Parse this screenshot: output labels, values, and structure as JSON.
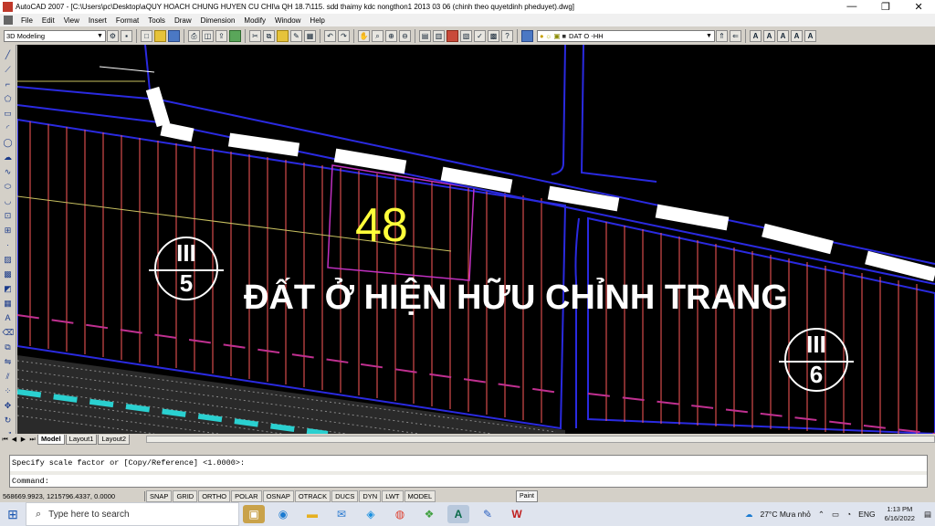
{
  "window": {
    "title": "AutoCAD 2007 - [C:\\Users\\pc\\Desktop\\aQUY HOACH CHUNG HUYEN CU CHI\\a QH 18.7\\115. sdd thaimy kdc nongthon1 2013 03 06 (chinh theo quyetdinh pheduyet).dwg]",
    "minimize": "—",
    "restore": "❐",
    "close": "✕"
  },
  "menu": {
    "items": [
      "File",
      "Edit",
      "View",
      "Insert",
      "Format",
      "Tools",
      "Draw",
      "Dimension",
      "Modify",
      "Window",
      "Help"
    ]
  },
  "toolbar": {
    "workspace": "3D Modeling",
    "layer": "DAT O -HH",
    "text_icons": [
      "A",
      "A",
      "A",
      "A",
      "A"
    ]
  },
  "drawing": {
    "lot_number": "48",
    "zone_label": "ĐẤT Ở HIỆN HỮU CHỈNH TRANG",
    "markers": [
      {
        "top": "III",
        "bottom": "5"
      },
      {
        "top": "III",
        "bottom": "6"
      }
    ],
    "colors": {
      "background": "#000000",
      "lot_number": "#ffff3a",
      "parcel_lines": "#ff5a5a",
      "boundary": "#2222cc",
      "road_dash": "#ffffff"
    }
  },
  "layout_tabs": [
    "Model",
    "Layout1",
    "Layout2"
  ],
  "command": {
    "history": "Specify scale factor or [Copy/Reference] <1.0000>:",
    "prompt": "Command:"
  },
  "status": {
    "coords": "568669.9923, 1215796.4337, 0.0000",
    "toggles": [
      "SNAP",
      "GRID",
      "ORTHO",
      "POLAR",
      "OSNAP",
      "OTRACK",
      "DUCS",
      "DYN",
      "LWT",
      "MODEL"
    ],
    "tooltip": "Paint"
  },
  "taskbar": {
    "search_placeholder": "Type here to search",
    "weather": "27°C  Mưa nhỏ",
    "lang": "ENG",
    "time": "1:13 PM",
    "date": "6/16/2022"
  }
}
